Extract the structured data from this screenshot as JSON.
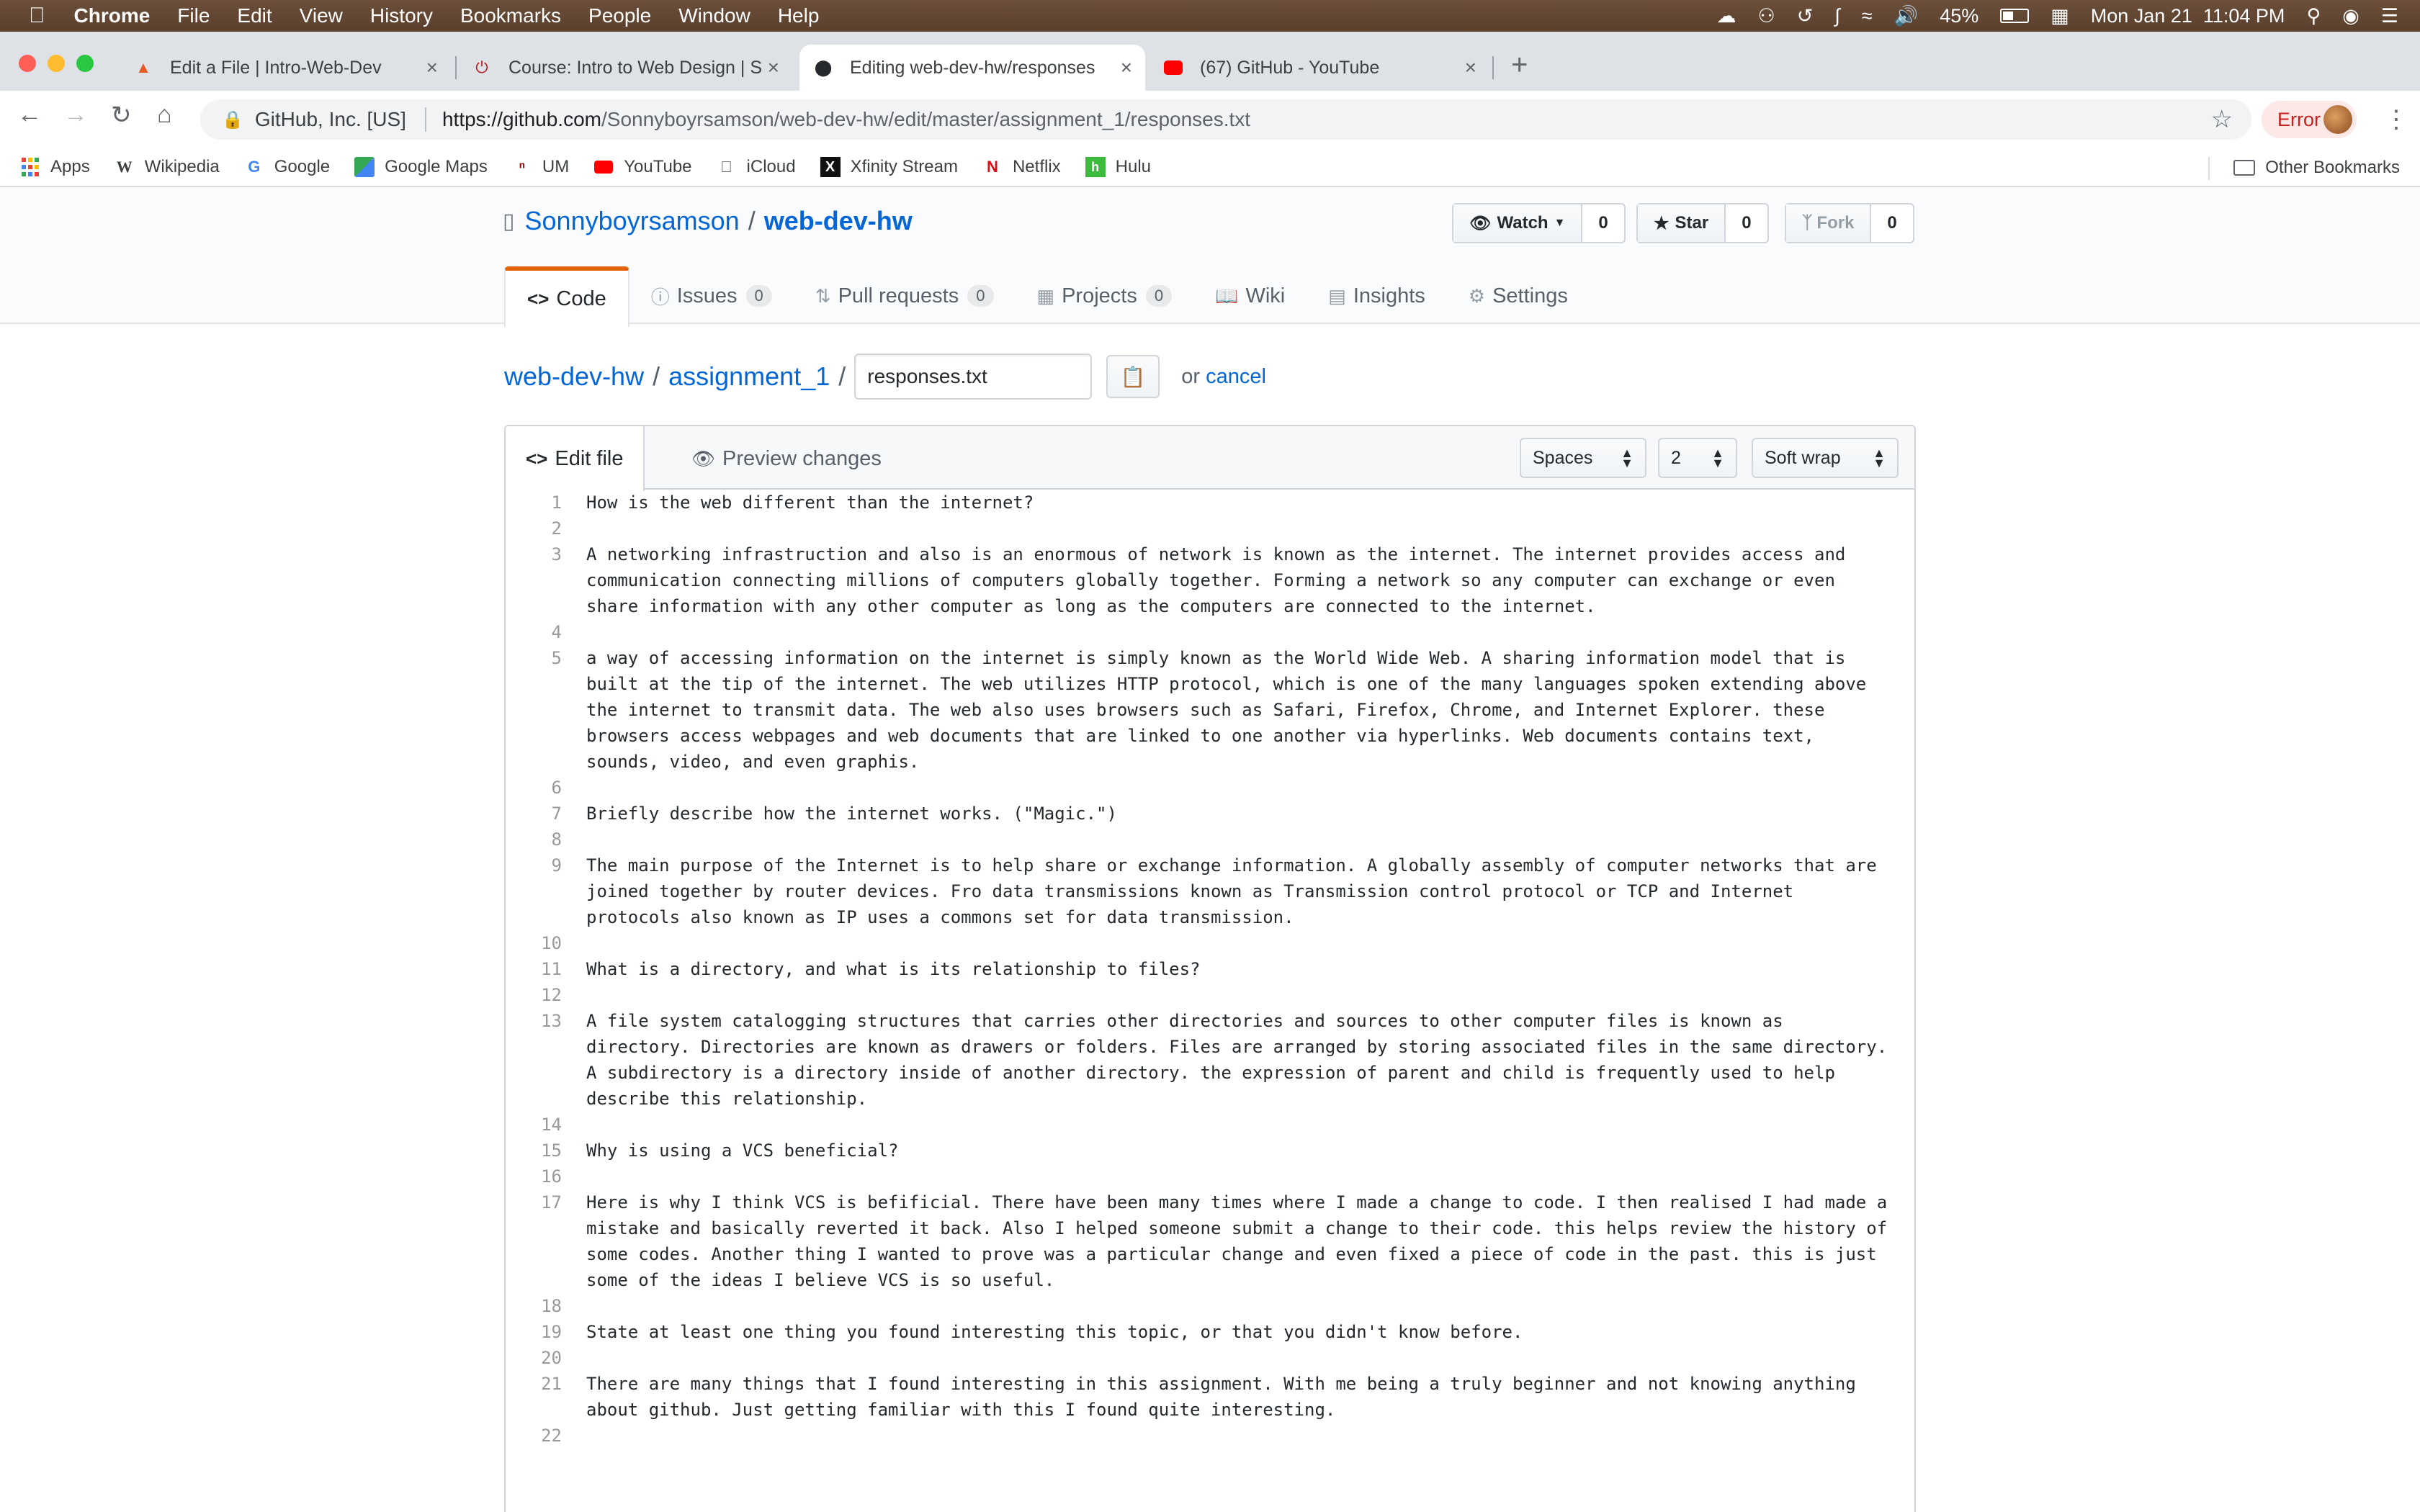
{
  "menubar": {
    "app": "Chrome",
    "items": [
      "File",
      "Edit",
      "View",
      "History",
      "Bookmarks",
      "People",
      "Window",
      "Help"
    ],
    "battery": "45%",
    "datetime": "Mon Jan 21  11:04 PM"
  },
  "tabs": [
    {
      "title": "Edit a File | Intro-Web-Dev",
      "icon": "shield-favicon-icon"
    },
    {
      "title": "Course: Intro to Web Design | S",
      "icon": "power-favicon-icon"
    },
    {
      "title": "Editing web-dev-hw/responses",
      "icon": "github-favicon-icon",
      "active": true
    },
    {
      "title": "(67) GitHub - YouTube",
      "icon": "youtube-favicon-icon"
    }
  ],
  "address": {
    "org": "GitHub, Inc. [US]",
    "url_host": "https://github.com",
    "url_path": "/Sonnyboyrsamson/web-dev-hw/edit/master/assignment_1/responses.txt",
    "error_label": "Error"
  },
  "bookmarks": [
    {
      "label": "Apps",
      "icon": "apps-grid-icon"
    },
    {
      "label": "Wikipedia",
      "icon": "wikipedia-icon"
    },
    {
      "label": "Google",
      "icon": "google-icon"
    },
    {
      "label": "Google Maps",
      "icon": "google-maps-icon"
    },
    {
      "label": "UM",
      "icon": "um-icon"
    },
    {
      "label": "YouTube",
      "icon": "youtube-icon"
    },
    {
      "label": "iCloud",
      "icon": "apple-icon"
    },
    {
      "label": "Xfinity Stream",
      "icon": "xfinity-icon"
    },
    {
      "label": "Netflix",
      "icon": "netflix-icon"
    },
    {
      "label": "Hulu",
      "icon": "hulu-icon"
    }
  ],
  "other_bookmarks": "Other Bookmarks",
  "repo": {
    "owner": "Sonnyboyrsamson",
    "name": "web-dev-hw",
    "watch_label": "Watch",
    "watch_count": "0",
    "star_label": "Star",
    "star_count": "0",
    "fork_label": "Fork",
    "fork_count": "0"
  },
  "repo_nav": [
    {
      "label": "Code",
      "icon": "code-icon"
    },
    {
      "label": "Issues",
      "icon": "issue-icon",
      "count": "0"
    },
    {
      "label": "Pull requests",
      "icon": "pull-request-icon",
      "count": "0"
    },
    {
      "label": "Projects",
      "icon": "project-icon",
      "count": "0"
    },
    {
      "label": "Wiki",
      "icon": "book-icon"
    },
    {
      "label": "Insights",
      "icon": "graph-icon"
    },
    {
      "label": "Settings",
      "icon": "gear-icon"
    }
  ],
  "path": {
    "root": "web-dev-hw",
    "folder": "assignment_1",
    "filename": "responses.txt",
    "or_text": "or",
    "cancel": "cancel"
  },
  "editor": {
    "edit_tab": "Edit file",
    "preview_tab": "Preview changes",
    "indent_mode": "Spaces",
    "indent_size": "2",
    "wrap_mode": "Soft wrap"
  },
  "lines": [
    "How is the web different than the internet?",
    "",
    "A networking infrastruction and also is an enormous of network is known as the internet. The internet provides access and communication connecting millions of computers globally together. Forming a network so any computer can exchange or even share information with any other computer as long as the computers are connected to the internet.",
    "",
    "a way of accessing information on the internet is simply known as the World Wide Web. A sharing information model that is built at the tip of the internet. The web utilizes HTTP protocol, which is one of the many languages spoken extending above the internet to transmit data. The web also uses browsers such as Safari, Firefox, Chrome, and Internet Explorer. these browsers access webpages and web documents that are linked to one another via hyperlinks. Web documents contains text, sounds, video, and even graphis.",
    "",
    "Briefly describe how the internet works. (\"Magic.\")",
    "",
    "The main purpose of the Internet is to help share or exchange information. A globally assembly of computer networks that are joined together by router devices. Fro data transmissions known as Transmission control protocol or TCP and Internet protocols also known as IP uses a commons set for data transmission.",
    "",
    "What is a directory, and what is its relationship to files?",
    "",
    "A file system catalogging structures that carries other directories and sources to other computer files is known as directory. Directories are known as drawers or folders. Files are arranged by storing associated files in the same directory. A subdirectory is a directory inside of another directory. the expression of parent and child is frequently used to help describe this relationship.",
    "",
    "Why is using a VCS beneficial?",
    "",
    "Here is why I think VCS is befificial. There have been many times where I made a change to code. I then realised I had made a mistake and basically reverted it back. Also I helped someone submit a change to their code. this helps review the history of some codes. Another thing I wanted to prove was a particular change and even fixed a piece of code in the past. this is just some of the ideas I believe VCS is so useful.",
    "",
    "State at least one thing you found interesting this topic, or that you didn't know before.",
    "",
    "There are many things that I found interesting in this assignment. With me being a truly beginner and not knowing anything about github. Just getting familiar with this I found quite interesting.",
    ""
  ]
}
